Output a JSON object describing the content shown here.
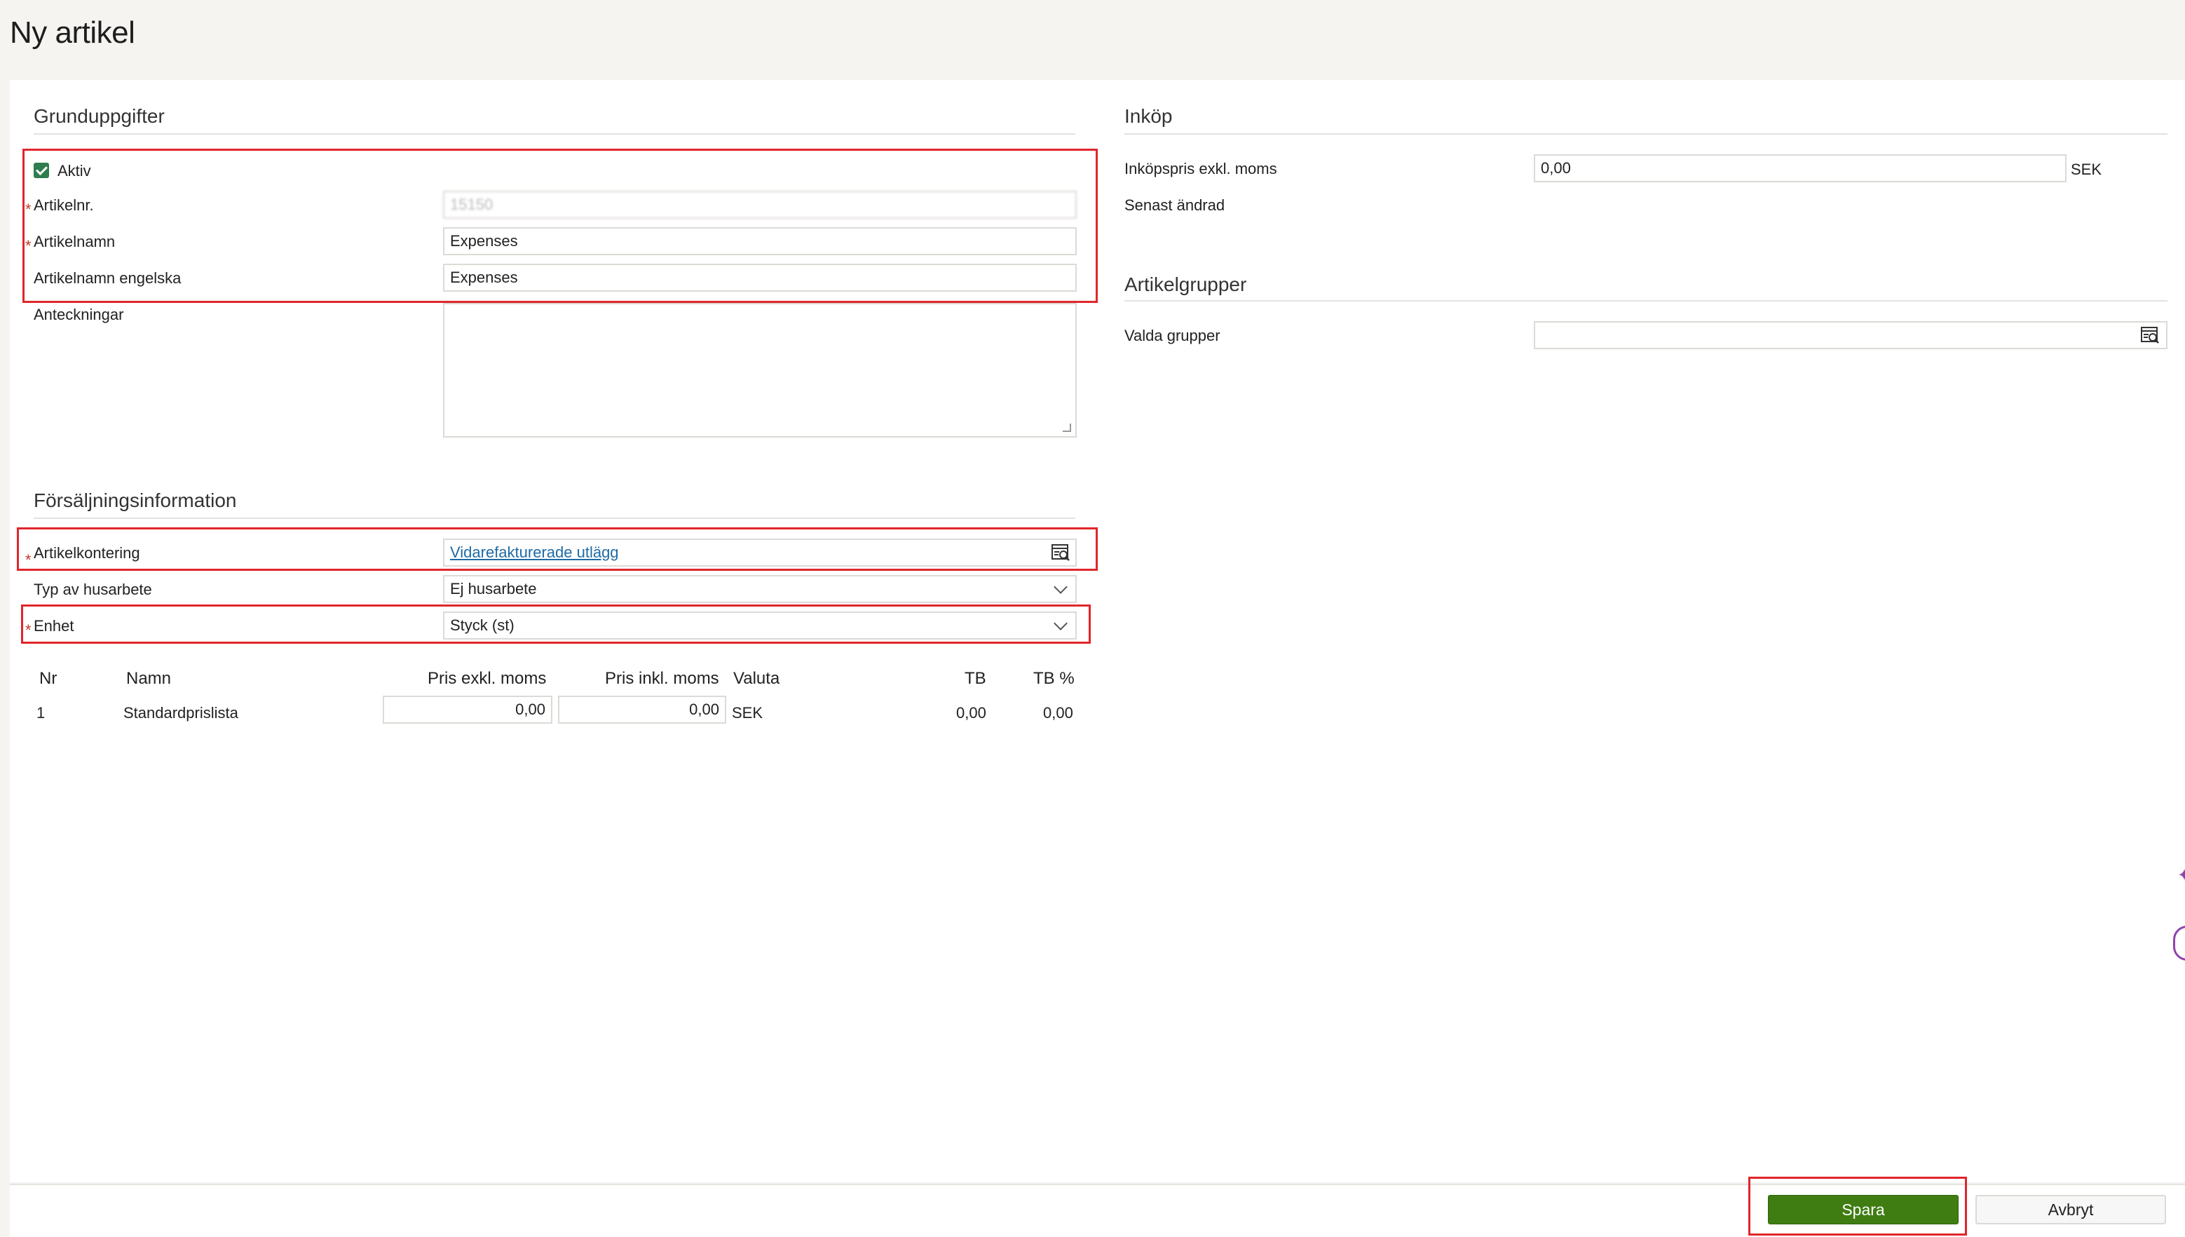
{
  "page": {
    "title": "Ny artikel"
  },
  "basic": {
    "section_title": "Grunduppgifter",
    "active_label": "Aktiv",
    "active_checked": true,
    "article_no_label": "Artikelnr.",
    "article_no_value": "15150",
    "article_name_label": "Artikelnamn",
    "article_name_value": "Expenses",
    "article_name_en_label": "Artikelnamn engelska",
    "article_name_en_value": "Expenses",
    "notes_label": "Anteckningar",
    "required_mark": "*"
  },
  "sales": {
    "section_title": "Försäljningsinformation",
    "accounting_label": "Artikelkontering",
    "accounting_value": "Vidarefakturerade utlägg",
    "house_work_label": "Typ av husarbete",
    "house_work_value": "Ej husarbete",
    "unit_label": "Enhet",
    "unit_value": "Styck (st)"
  },
  "price_table": {
    "headers": {
      "nr": "Nr",
      "name": "Namn",
      "price_excl": "Pris exkl. moms",
      "price_incl": "Pris inkl. moms",
      "currency": "Valuta",
      "tb": "TB",
      "tb_pct": "TB %"
    },
    "rows": [
      {
        "nr": "1",
        "name": "Standardprislista",
        "price_excl": "0,00",
        "price_incl": "0,00",
        "currency": "SEK",
        "tb": "0,00",
        "tb_pct": "0,00"
      }
    ]
  },
  "purchase": {
    "section_title": "Inköp",
    "price_label": "Inköpspris exkl. moms",
    "price_value": "0,00",
    "currency": "SEK",
    "last_changed_label": "Senast ändrad"
  },
  "groups": {
    "section_title": "Artikelgrupper",
    "selected_label": "Valda grupper",
    "selected_value": ""
  },
  "footer": {
    "save_label": "Spara",
    "cancel_label": "Avbryt"
  },
  "colors": {
    "save_button": "#3f7d12",
    "highlight": "#e0262b",
    "link": "#1f6aa5",
    "required": "#c0392b"
  },
  "icons": {
    "lookup": "lookup-icon",
    "dropdown": "chevron-down-icon",
    "resize": "resize-handle-icon"
  }
}
